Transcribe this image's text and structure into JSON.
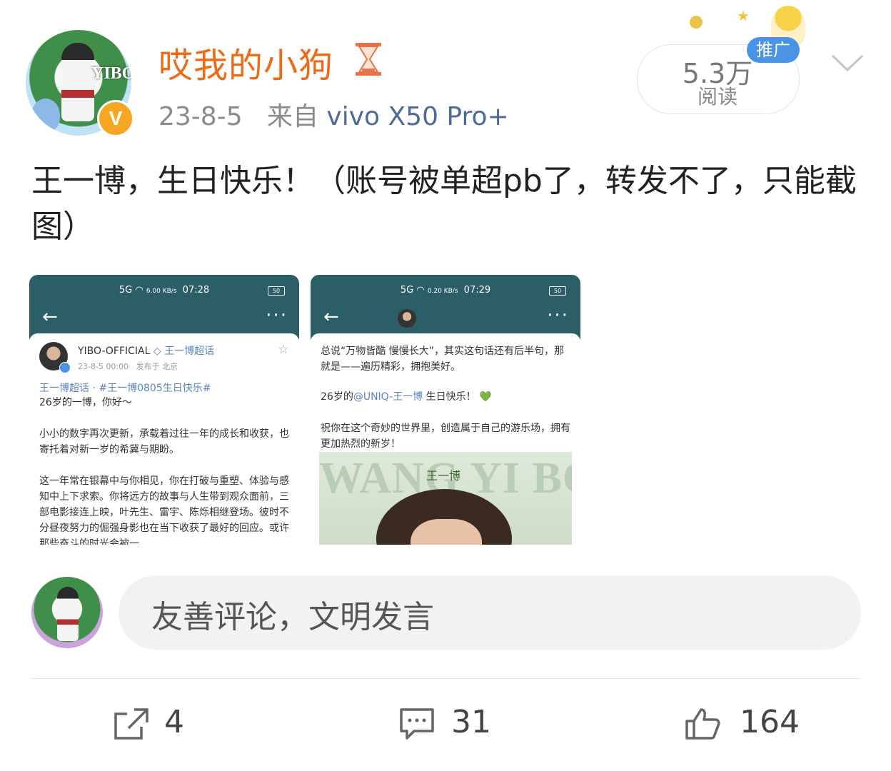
{
  "author": {
    "name": "哎我的小狗",
    "avatar_text": "YIBO",
    "verified_mark": "V"
  },
  "meta": {
    "date": "23-8-5",
    "source_prefix": "来自",
    "device": "vivo X50 Pro+"
  },
  "reads": {
    "count": "5.3万",
    "label": "阅读",
    "ad_badge": "推广"
  },
  "post_text": "王一博，生日快乐！（账号被单超pb了，转发不了，只能截图）",
  "thumbnails": [
    {
      "signal": "5G",
      "net": "6.00 KB/s",
      "time": "07:28",
      "battery": "50",
      "account": "YIBO-OFFICIAL",
      "topic": "王一博超话",
      "date": "23-8-5 00:00",
      "location": "发布于 北京",
      "tags": "王一博超话 · #王一博0805生日快乐#",
      "lines": [
        "26岁的一博，你好～",
        "小小的数字再次更新，承载着过往一年的成长和收获，也寄托着对新一岁的希冀与期盼。",
        "这一年常在银幕中与你相见，你在打破与重塑、体验与感知中上下求索。你将远方的故事与人生带到观众面前，三部电影接连上映，叶先生、雷宇、陈烁相继登场。彼时不分昼夜努力的倔强身影也在当下收获了最好的回应。或许那些奋斗的时光会被一"
      ]
    },
    {
      "signal": "5G",
      "net": "0.20 KB/s",
      "time": "07:29",
      "battery": "50",
      "line1": "总说“万物皆酷 慢慢长大”，其实这句话还有后半句，那就是——遍历精彩，拥抱美好。",
      "line2_prefix": "26岁的",
      "mention": "@UNIQ-王一博",
      "line2_suffix": " 生日快乐！",
      "heart": "💚",
      "line3": "祝你在这个奇妙的世界里，创造属于自己的游乐场，拥有更加热烈的新岁！",
      "promo_title": "WANG YI BO",
      "promo_name": "王一博"
    }
  ],
  "comment": {
    "placeholder": "友善评论，文明发言"
  },
  "actions": {
    "share_count": "4",
    "comment_count": "31",
    "like_count": "164"
  },
  "colors": {
    "username": "#f06a16",
    "device_link": "#506a96",
    "thumb_header": "#2b5e66",
    "ad_badge": "#4a93e4",
    "verified": "#f5a623"
  }
}
